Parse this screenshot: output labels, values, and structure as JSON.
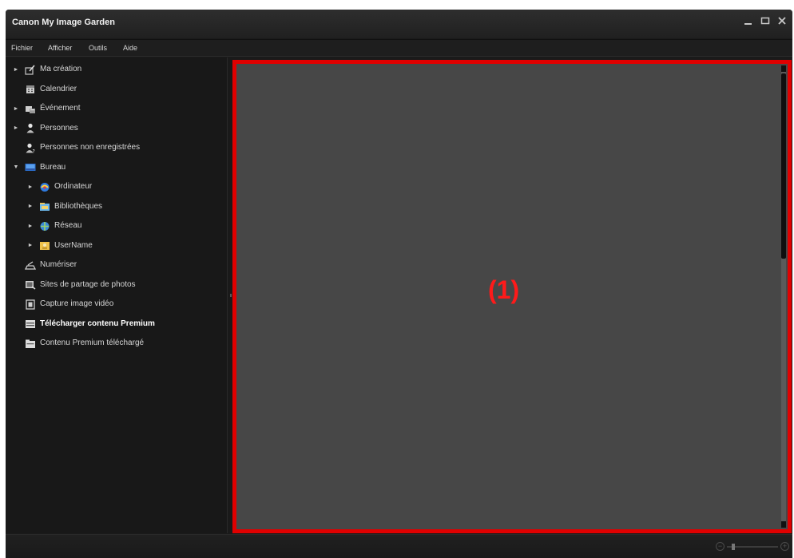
{
  "window": {
    "title": "Canon My Image Garden"
  },
  "menu": [
    "Fichier",
    "Afficher",
    "Outils",
    "Aide"
  ],
  "tree": [
    {
      "label": "Ma création",
      "icon": "my-art-icon",
      "expander": "collapsed",
      "depth": 0
    },
    {
      "label": "Calendrier",
      "icon": "calendar-icon",
      "expander": "none",
      "depth": 0
    },
    {
      "label": "Événement",
      "icon": "event-icon",
      "expander": "collapsed",
      "depth": 0
    },
    {
      "label": "Personnes",
      "icon": "people-icon",
      "expander": "collapsed",
      "depth": 0
    },
    {
      "label": "Personnes non enregistrées",
      "icon": "unregistered-people-icon",
      "expander": "none",
      "depth": 0
    },
    {
      "label": "Bureau",
      "icon": "desktop-icon",
      "expander": "expanded",
      "depth": 0
    },
    {
      "label": "Ordinateur",
      "icon": "computer-icon",
      "expander": "collapsed",
      "depth": 1
    },
    {
      "label": "Bibliothèques",
      "icon": "libraries-icon",
      "expander": "collapsed",
      "depth": 1
    },
    {
      "label": "Réseau",
      "icon": "network-icon",
      "expander": "collapsed",
      "depth": 1
    },
    {
      "label": "UserName",
      "icon": "user-folder-icon",
      "expander": "collapsed",
      "depth": 1
    },
    {
      "label": "Numériser",
      "icon": "scan-icon",
      "expander": "none",
      "depth": 0
    },
    {
      "label": "Sites de partage de photos",
      "icon": "photo-sharing-icon",
      "expander": "none",
      "depth": 0
    },
    {
      "label": "Capture image vidéo",
      "icon": "video-capture-icon",
      "expander": "none",
      "depth": 0
    },
    {
      "label": "Télécharger contenu Premium",
      "icon": "download-premium-icon",
      "expander": "none",
      "depth": 0,
      "selected": true
    },
    {
      "label": "Contenu Premium téléchargé",
      "icon": "downloaded-premium-icon",
      "expander": "none",
      "depth": 0
    }
  ],
  "content": {
    "marker": "(1)"
  },
  "colors": {
    "highlight_border": "#e00000",
    "marker_text": "#ff1a1a",
    "content_bg": "#474747"
  },
  "zoom": {
    "minus_symbol": "−",
    "plus_symbol": "+",
    "level_fraction": 0.1
  }
}
